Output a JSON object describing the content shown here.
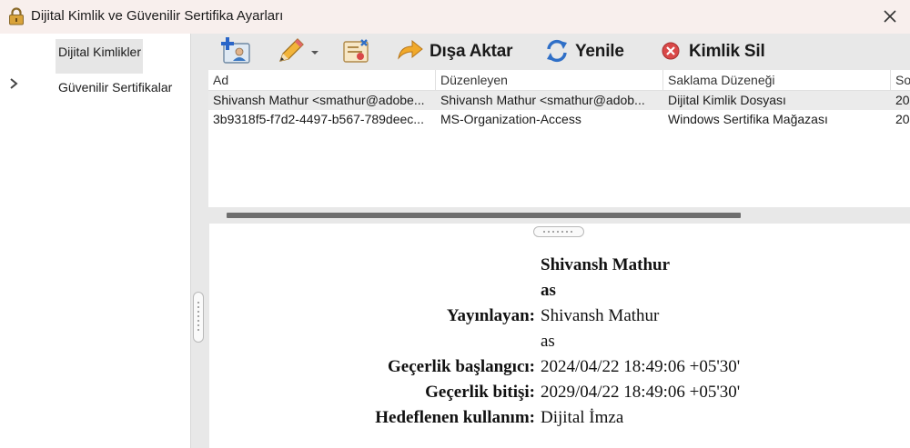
{
  "window": {
    "title": "Dijital Kimlik ve Güvenilir Sertifika Ayarları",
    "title_icon": "lock-icon",
    "close_icon": "close-icon"
  },
  "nav": {
    "items": [
      {
        "label": "Dijital Kimlikler",
        "selected": true
      },
      {
        "label": "Güvenilir Sertifikalar",
        "selected": false
      }
    ]
  },
  "toolbar": {
    "add_icon": "add-id-icon",
    "edit_icon": "pencil-icon",
    "details_icon": "certificate-details-icon",
    "export_label": "Dışa Aktar",
    "export_icon": "export-arrow-icon",
    "refresh_label": "Yenile",
    "refresh_icon": "refresh-icon",
    "remove_label": "Kimlik Sil",
    "remove_icon": "remove-icon"
  },
  "table": {
    "columns": [
      "Ad",
      "Düzenleyen",
      "Saklama Düzeneği",
      "So"
    ],
    "rows": [
      [
        "Shivansh Mathur <smathur@adobe...",
        "Shivansh Mathur <smathur@adob...",
        "Dijital Kimlik Dosyası",
        "20"
      ],
      [
        "3b9318f5-f7d2-4497-b567-789deec...",
        "MS-Organization-Access",
        "Windows Sertifika Mağazası",
        "20"
      ]
    ],
    "selected_row": 0
  },
  "details": {
    "name_line1": "Shivansh Mathur",
    "name_line2": "as",
    "issuer_label": "Yayınlayan:",
    "issuer_line1": "Shivansh Mathur",
    "issuer_line2": "as",
    "valid_from_label": "Geçerlik başlangıcı:",
    "valid_from": "2024/04/22 18:49:06 +05'30'",
    "valid_to_label": "Geçerlik bitişi:",
    "valid_to": "2029/04/22 18:49:06 +05'30'",
    "usage_label": "Hedeflenen kullanım:",
    "usage": "Dijital İmza"
  },
  "colors": {
    "titlebar_bg": "#f8efed",
    "toolbar_bg": "#e8e8e8",
    "selected_row_bg": "#ebebeb",
    "export_arrow": "#f0a92b",
    "refresh_blue": "#2f6fc7",
    "remove_red": "#d94848"
  }
}
